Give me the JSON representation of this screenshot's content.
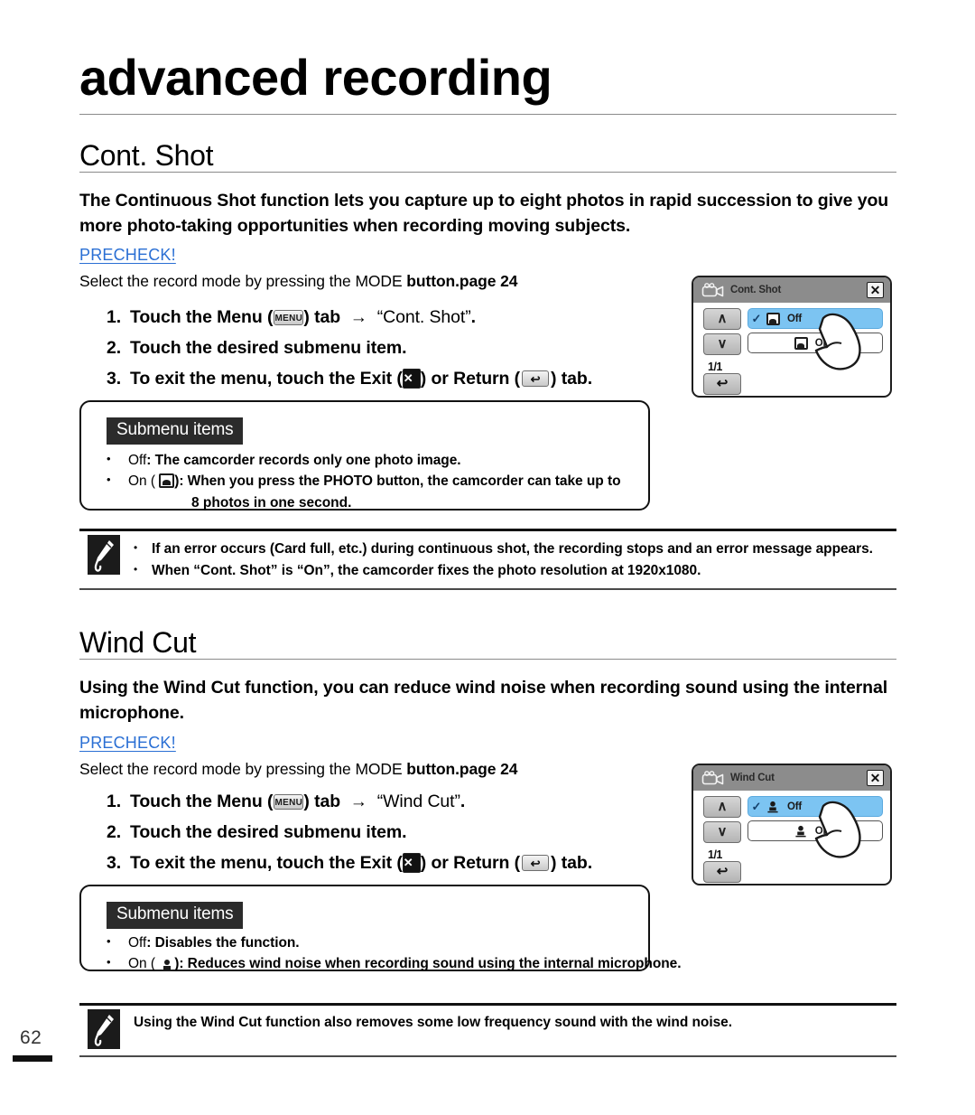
{
  "page": {
    "chapter_title": "advanced recording",
    "page_number": "62"
  },
  "sections": [
    {
      "heading": "Cont. Shot",
      "intro": "The Continuous Shot function lets you capture up to eight photos in rapid succession to give you more photo-taking opportunities when recording moving subjects.",
      "precheck_label": "PRECHECK!",
      "precheck_lead": "Select the record mode by pressing the ",
      "precheck_mode": "MODE",
      "precheck_tail": " button.",
      "precheck_page_ref": "page 24",
      "steps": [
        {
          "num": "1.",
          "pre": "Touch the Menu (",
          "icon": "menu-icon",
          "icon_label": "MENU",
          "mid": ") tab  →  ",
          "quoted": "“Cont. Shot”",
          "post": "."
        },
        {
          "num": "2.",
          "pre": "Touch the desired submenu item.",
          "icon": "",
          "mid": "",
          "quoted": "",
          "post": ""
        },
        {
          "num": "3.",
          "pre": "To exit the menu, touch the Exit (",
          "icon": "close-icon",
          "icon_label": "✕",
          "mid": ") or Return (",
          "icon2": "return-icon",
          "icon2_label": "↩",
          "post": ") tab."
        }
      ],
      "submenu": {
        "label": "Submenu items",
        "items": [
          {
            "name": "Off",
            "icon": "",
            "desc": ": The camcorder records only one photo image.",
            "cont": ""
          },
          {
            "name": "On",
            "icon": "burst-photo-icon",
            "desc": "): When you press the PHOTO button, the camcorder can take up to",
            "cont": "8 photos in one second."
          }
        ]
      },
      "notes": [
        "If an error occurs (Card full, etc.) during continuous shot, the recording stops and an error message appears.",
        "When “Cont. Shot” is “On”, the camcorder fixes the photo resolution at 1920x1080."
      ],
      "lcd": {
        "title": "Cont. Shot",
        "cam_icon": "camcorder-icon",
        "close_label": "✕",
        "up_label": "∧",
        "down_label": "∨",
        "page_indicator": "1/1",
        "return_label": "↩",
        "rows": [
          {
            "check": "✓",
            "icon": "burst-photo-icon",
            "label": "Off",
            "selected": true
          },
          {
            "check": "",
            "icon": "photo-icon",
            "label": "On",
            "selected": false
          }
        ]
      }
    },
    {
      "heading": "Wind Cut",
      "intro": "Using the Wind Cut function, you can reduce wind noise when recording sound using the internal microphone.",
      "precheck_label": "PRECHECK!",
      "precheck_lead": "Select the record mode by pressing the ",
      "precheck_mode": "MODE",
      "precheck_tail": " button.",
      "precheck_page_ref": "page 24",
      "steps": [
        {
          "num": "1.",
          "pre": "Touch the Menu (",
          "icon": "menu-icon",
          "icon_label": "MENU",
          "mid": ") tab  →  ",
          "quoted": "“Wind Cut”",
          "post": "."
        },
        {
          "num": "2.",
          "pre": "Touch the desired submenu item.",
          "icon": "",
          "mid": "",
          "quoted": "",
          "post": ""
        },
        {
          "num": "3.",
          "pre": "To exit the menu, touch the Exit (",
          "icon": "close-icon",
          "icon_label": "✕",
          "mid": ") or Return (",
          "icon2": "return-icon",
          "icon2_label": "↩",
          "post": ") tab."
        }
      ],
      "submenu": {
        "label": "Submenu items",
        "items": [
          {
            "name": "Off",
            "icon": "",
            "desc": ": Disables the function.",
            "cont": ""
          },
          {
            "name": "On",
            "icon": "wind-cut-icon",
            "desc": "): Reduces wind noise when recording sound using the internal microphone.",
            "cont": ""
          }
        ]
      },
      "notes": [
        "Using the Wind Cut function also removes some low frequency sound with the wind noise."
      ],
      "lcd": {
        "title": "Wind Cut",
        "cam_icon": "camcorder-icon",
        "close_label": "✕",
        "up_label": "∧",
        "down_label": "∨",
        "page_indicator": "1/1",
        "return_label": "↩",
        "rows": [
          {
            "check": "✓",
            "icon": "wind-cut-icon",
            "label": "Off",
            "selected": true
          },
          {
            "check": "",
            "icon": "wind-cut-icon",
            "label": "On",
            "selected": false
          }
        ]
      }
    }
  ],
  "colors": {
    "precheck_link": "#2a6fd4",
    "lcd_selected": "#7cc4f2",
    "lcd_titlebar": "#8c8c8c",
    "rule": "#8a8a8a"
  }
}
